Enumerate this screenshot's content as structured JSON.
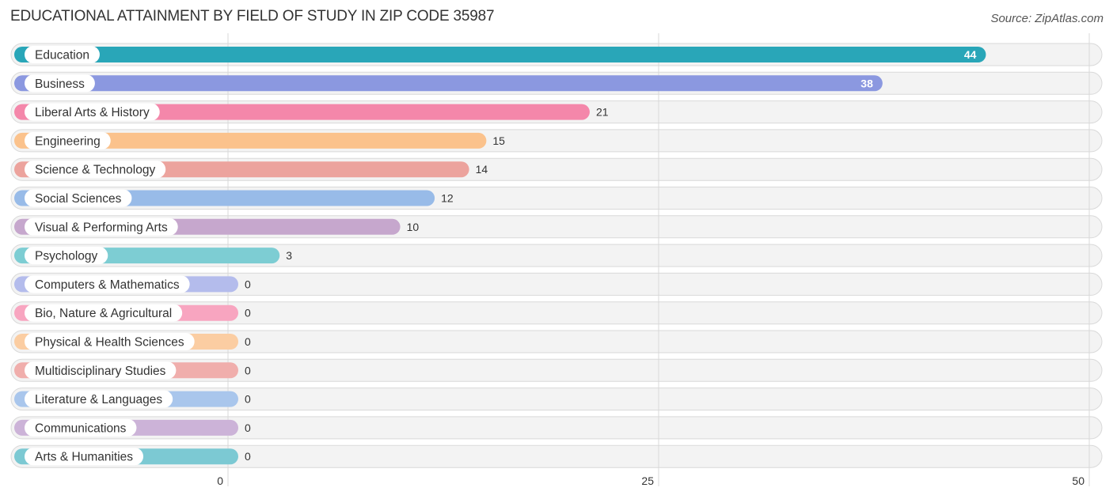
{
  "chart_data": {
    "type": "bar",
    "orientation": "horizontal",
    "title": "EDUCATIONAL ATTAINMENT BY FIELD OF STUDY IN ZIP CODE 35987",
    "source": "Source: ZipAtlas.com",
    "xlabel": "",
    "ylabel": "",
    "xlim": [
      0,
      50
    ],
    "xticks": [
      0,
      25,
      50
    ],
    "grid": true,
    "categories": [
      "Education",
      "Business",
      "Liberal Arts & History",
      "Engineering",
      "Science & Technology",
      "Social Sciences",
      "Visual & Performing Arts",
      "Psychology",
      "Computers & Mathematics",
      "Bio, Nature & Agricultural",
      "Physical & Health Sciences",
      "Multidisciplinary Studies",
      "Literature & Languages",
      "Communications",
      "Arts & Humanities"
    ],
    "values": [
      44,
      38,
      21,
      15,
      14,
      12,
      10,
      3,
      0,
      0,
      0,
      0,
      0,
      0,
      0
    ],
    "colors": [
      "#29a6b8",
      "#8b98e0",
      "#f487aa",
      "#fbc28c",
      "#eca39d",
      "#98bbe8",
      "#c6a7cd",
      "#7dcdd3",
      "#b4bcec",
      "#f8a5c0",
      "#fbcda2",
      "#f0aeac",
      "#a9c6ec",
      "#ccb3d8",
      "#7cc9d3"
    ],
    "value_label_inside": [
      true,
      true,
      false,
      false,
      false,
      false,
      false,
      false,
      false,
      false,
      false,
      false,
      false,
      false,
      false
    ]
  }
}
